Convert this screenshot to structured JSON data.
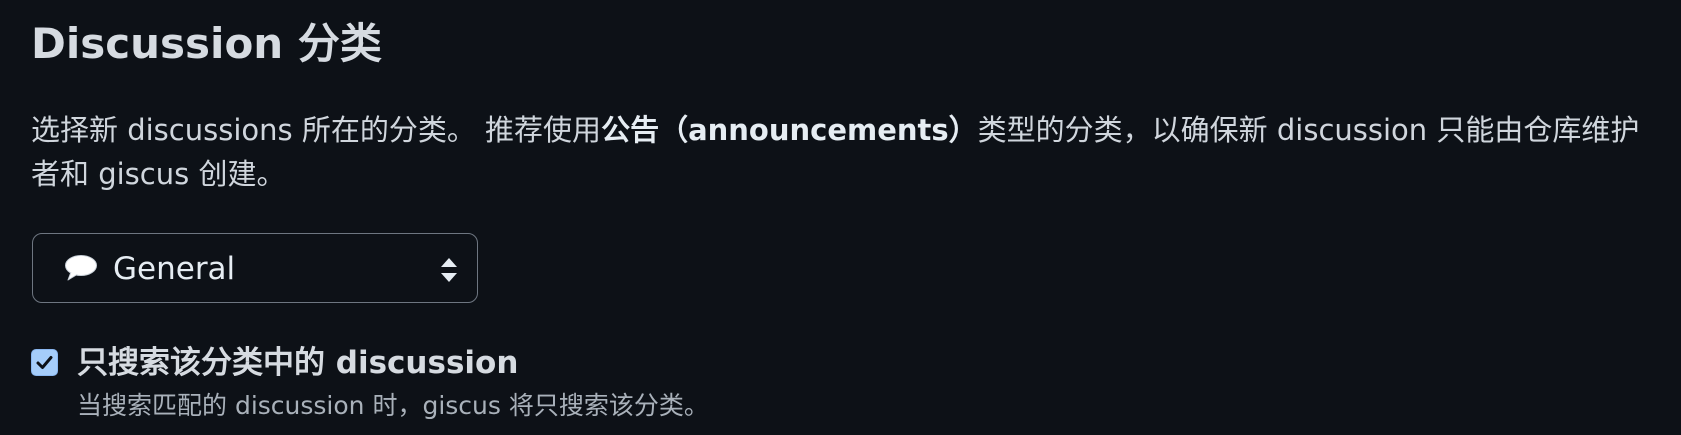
{
  "section": {
    "title": "Discussion 分类",
    "description_part1": "选择新 discussions 所在的分类。 推荐使用",
    "description_bold": "公告（announcements）",
    "description_part2": "类型的分类，以确保新 discussion 只能由仓库维护者和 giscus 创建。"
  },
  "category_select": {
    "selected_value": "General",
    "icon": "speech-bubble-icon"
  },
  "strict_category_option": {
    "checked": true,
    "label": "只搜索该分类中的 discussion",
    "hint": "当搜索匹配的 discussion 时，giscus 将只搜索该分类。"
  },
  "colors": {
    "background": "#0d1117",
    "text": "#e6edf3",
    "muted_text": "#a9b1ba",
    "border": "#6e7681",
    "checkbox_fill": "#a5cdfa"
  }
}
